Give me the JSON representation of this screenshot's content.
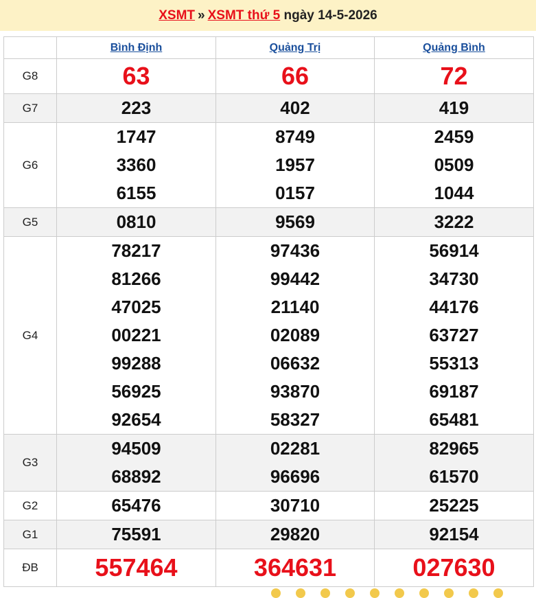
{
  "header": {
    "link1": "XSMT",
    "separator": "»",
    "link2": "XSMT thứ 5",
    "date_text": "ngày 14-5-2026"
  },
  "provinces": [
    "Bình Định",
    "Quảng Trị",
    "Quảng Bình"
  ],
  "prizes": {
    "G8": {
      "label": "G8",
      "values": [
        [
          "63"
        ],
        [
          "66"
        ],
        [
          "72"
        ]
      ]
    },
    "G7": {
      "label": "G7",
      "values": [
        [
          "223"
        ],
        [
          "402"
        ],
        [
          "419"
        ]
      ]
    },
    "G6": {
      "label": "G6",
      "values": [
        [
          "1747",
          "3360",
          "6155"
        ],
        [
          "8749",
          "1957",
          "0157"
        ],
        [
          "2459",
          "0509",
          "1044"
        ]
      ]
    },
    "G5": {
      "label": "G5",
      "values": [
        [
          "0810"
        ],
        [
          "9569"
        ],
        [
          "3222"
        ]
      ]
    },
    "G4": {
      "label": "G4",
      "values": [
        [
          "78217",
          "81266",
          "47025",
          "00221",
          "99288",
          "56925",
          "92654"
        ],
        [
          "97436",
          "99442",
          "21140",
          "02089",
          "06632",
          "93870",
          "58327"
        ],
        [
          "56914",
          "34730",
          "44176",
          "63727",
          "55313",
          "69187",
          "65481"
        ]
      ]
    },
    "G3": {
      "label": "G3",
      "values": [
        [
          "94509",
          "68892"
        ],
        [
          "02281",
          "96696"
        ],
        [
          "82965",
          "61570"
        ]
      ]
    },
    "G2": {
      "label": "G2",
      "values": [
        [
          "65476"
        ],
        [
          "30710"
        ],
        [
          "25225"
        ]
      ]
    },
    "G1": {
      "label": "G1",
      "values": [
        [
          "75591"
        ],
        [
          "29820"
        ],
        [
          "92154"
        ]
      ]
    },
    "DB": {
      "label": "ĐB",
      "values": [
        [
          "557464"
        ],
        [
          "364631"
        ],
        [
          "027630"
        ]
      ]
    }
  },
  "colors": {
    "accent_red": "#e8101a",
    "header_bg": "#fdf2c6",
    "province_link": "#1a4f9c",
    "alt_row": "#f2f2f2"
  }
}
